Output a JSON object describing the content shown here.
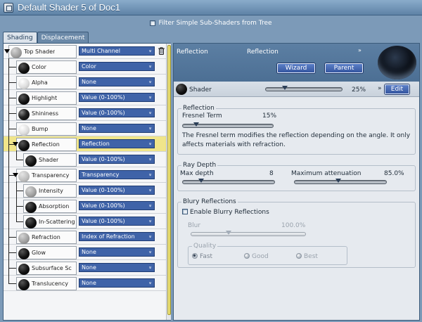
{
  "window": {
    "title": "Default Shader 5 of Doc1"
  },
  "filter": {
    "label": "Filter Simple Sub-Shaders from Tree",
    "checked": false
  },
  "tabs": [
    {
      "label": "Shading",
      "active": true
    },
    {
      "label": "Displacement",
      "active": false
    }
  ],
  "tree": {
    "rows": [
      {
        "label": "Top Shader",
        "value": "Multi Channel",
        "ball": "grey"
      },
      {
        "label": "Color",
        "value": "Color",
        "ball": "black"
      },
      {
        "label": "Alpha",
        "value": "None",
        "ball": "white"
      },
      {
        "label": "Highlight",
        "value": "Value (0-100%)",
        "ball": "black"
      },
      {
        "label": "Shininess",
        "value": "Value (0-100%)",
        "ball": "spark"
      },
      {
        "label": "Bump",
        "value": "None",
        "ball": "white"
      },
      {
        "label": "Reflection",
        "value": "Reflection",
        "ball": "black",
        "selected": true
      },
      {
        "label": "Shader",
        "value": "Value (0-100%)",
        "ball": "black"
      },
      {
        "label": "Transparency",
        "value": "Transparency",
        "ball": "lgrey"
      },
      {
        "label": "Intensity",
        "value": "Value (0-100%)",
        "ball": "grey"
      },
      {
        "label": "Absorption",
        "value": "Value (0-100%)",
        "ball": "black"
      },
      {
        "label": "In-Scattering",
        "value": "Value (0-100%)",
        "ball": "black"
      },
      {
        "label": "Refraction",
        "value": "Index of Refraction",
        "ball": "grey"
      },
      {
        "label": "Glow",
        "value": "None",
        "ball": "black"
      },
      {
        "label": "Subsurface Sc",
        "value": "None",
        "ball": "black"
      },
      {
        "label": "Translucency",
        "value": "None",
        "ball": "black"
      }
    ]
  },
  "panel": {
    "header_left": "Reflection",
    "header_value": "Reflection",
    "wizard_label": "Wizard",
    "parent_label": "Parent",
    "shader_label": "Shader",
    "shader_percent": "25%",
    "shader_value": 0.25,
    "edit_label": "Edit"
  },
  "reflection_group": {
    "title": "Reflection",
    "fresnel_label": "Fresnel Term",
    "fresnel_value": "15%",
    "fresnel_fraction": 0.15,
    "description": "The Fresnel term modifies the reflection depending on the angle. It only affects materials with refraction."
  },
  "ray_depth_group": {
    "title": "Ray Depth",
    "max_depth_label": "Max depth",
    "max_depth_value": "8",
    "max_depth_fraction": 0.2,
    "max_atten_label": "Maximum attenuation",
    "max_atten_value": "85.0%",
    "max_atten_fraction": 0.48
  },
  "blurry_group": {
    "title": "Blury Reflections",
    "enable_label": "Enable Blurry Reflections",
    "enabled": false,
    "blur_label": "Blur",
    "blur_value": "100.0%",
    "blur_fraction": 0.33,
    "quality_title": "Quality",
    "quality_options": [
      "Fast",
      "Good",
      "Best"
    ],
    "quality_selected": "Fast"
  }
}
